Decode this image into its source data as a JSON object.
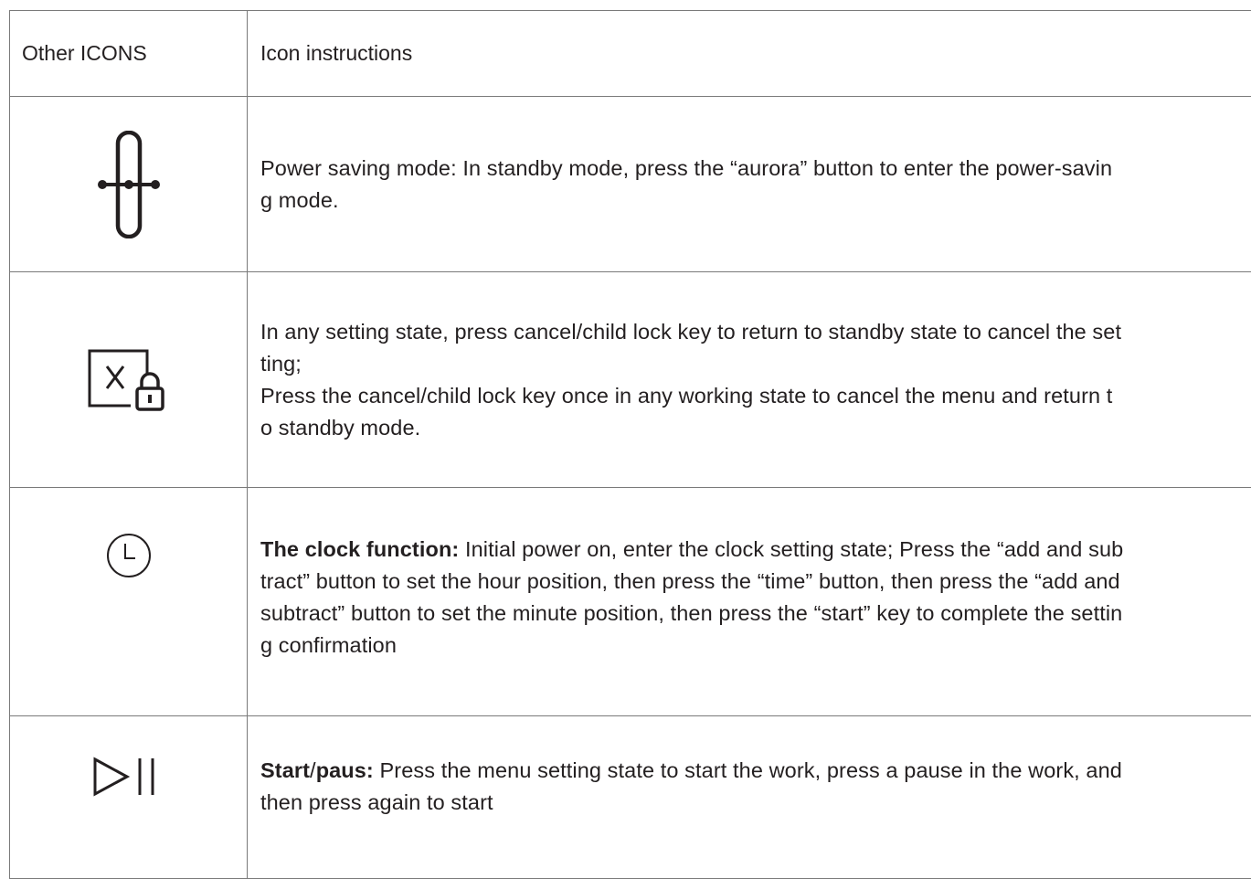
{
  "header": {
    "col1": "Other ICONS",
    "col2": "Icon instructions"
  },
  "rows": [
    {
      "icon": "power-saving-icon",
      "lines": [
        {
          "text": "Power saving mode: In standby mode, press the “aurora” button to enter the power-savin"
        },
        {
          "text": "g mode."
        }
      ]
    },
    {
      "icon": "cancel-child-lock-icon",
      "lines": [
        {
          "text": "In any setting state, press cancel/child lock key to return to standby state to cancel the set"
        },
        {
          "text": "ting;"
        },
        {
          "text": "Press the cancel/child lock key once in any working state to cancel the menu and return t"
        },
        {
          "text": "o standby mode."
        }
      ]
    },
    {
      "icon": "clock-icon",
      "bold": "The clock function:",
      "lines": [
        {
          "text": " Initial power on, enter the clock setting state; Press the “add and sub"
        },
        {
          "text": "tract” button to set the hour position, then press the “time” button, then press the “add and"
        },
        {
          "text": "subtract” button to set the minute position, then press the “start” key to complete the settin"
        },
        {
          "text": "g confirmation"
        }
      ]
    },
    {
      "icon": "start-pause-icon",
      "bold": "Start",
      "bold_suffix": "/",
      "bold2": "paus:",
      "lines": [
        {
          "text": " Press the menu setting state to start the work, press a pause in the work, and"
        },
        {
          "text": "then press again to start"
        }
      ]
    }
  ]
}
